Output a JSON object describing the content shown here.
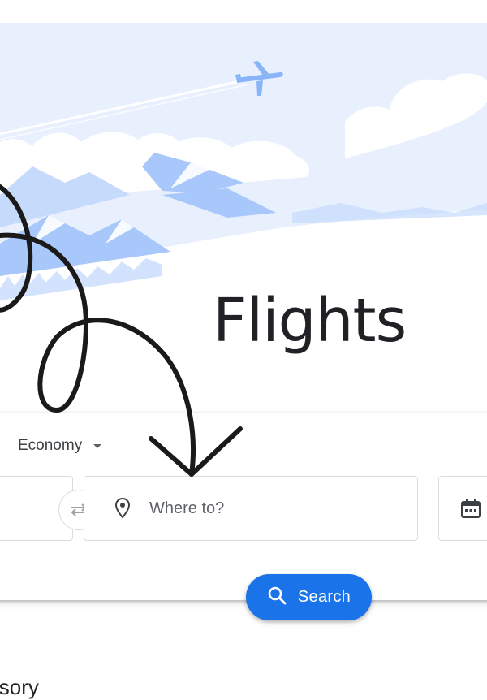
{
  "hero": {
    "illustration": "airplane-over-mountains-and-clouds"
  },
  "page": {
    "title": "Flights"
  },
  "search_form": {
    "seat_class": "Economy",
    "to_placeholder": "Where to?",
    "search_label": "Search"
  },
  "advisory": {
    "text": "visory"
  },
  "colors": {
    "sky": "#e8f0fe",
    "mountain": "#a8c7fa",
    "accent": "#1a73e8",
    "text": "#202124",
    "muted": "#5f6368",
    "border": "#dadce0"
  },
  "icons": {
    "swap": "swap-arrows-icon",
    "location": "location-pin-icon",
    "calendar": "calendar-icon",
    "search": "search-icon",
    "dropdown": "chevron-down-icon"
  },
  "overlay": {
    "annotation": "hand-drawn-loop-arrow"
  }
}
